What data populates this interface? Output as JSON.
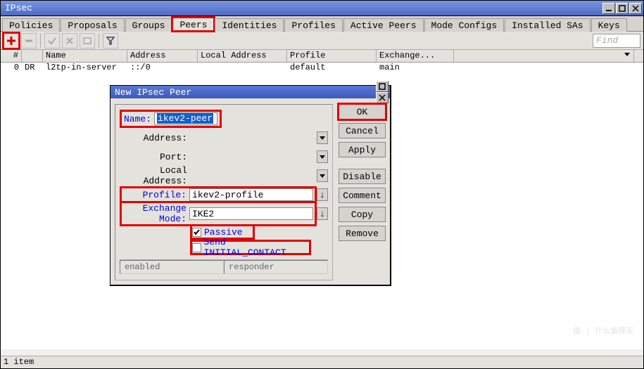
{
  "window": {
    "title": "IPsec"
  },
  "tabs": {
    "items": [
      "Policies",
      "Proposals",
      "Groups",
      "Peers",
      "Identities",
      "Profiles",
      "Active Peers",
      "Mode Configs",
      "Installed SAs",
      "Keys"
    ],
    "active": "Peers"
  },
  "toolbar": {
    "find_placeholder": "Find"
  },
  "table": {
    "columns": [
      "#",
      "",
      "Name",
      "Address",
      "Local Address",
      "Profile",
      "Exchange...",
      ""
    ],
    "rows": [
      {
        "num": "0",
        "flag": "DR",
        "name": "l2tp-in-server",
        "address": "::/0",
        "local_address": "",
        "profile": "default",
        "exchange": "main"
      }
    ]
  },
  "status": {
    "text": "1 item"
  },
  "dialog": {
    "title": "New IPsec Peer",
    "fields": {
      "name_label": "Name:",
      "name_value": "ikev2-peer",
      "address_label": "Address:",
      "address_value": "",
      "port_label": "Port:",
      "port_value": "",
      "local_address_label": "Local Address:",
      "local_address_value": "",
      "profile_label": "Profile:",
      "profile_value": "ikev2-profile",
      "exchange_label": "Exchange Mode:",
      "exchange_value": "IKE2",
      "passive_label": "Passive",
      "passive_checked": true,
      "send_initial_label": "Send INITIAL_CONTACT",
      "send_initial_checked": false
    },
    "buttons": {
      "ok": "OK",
      "cancel": "Cancel",
      "apply": "Apply",
      "disable": "Disable",
      "comment": "Comment",
      "copy": "Copy",
      "remove": "Remove"
    },
    "status_left": "enabled",
    "status_right": "responder"
  },
  "watermark": "值 | 什么值得买"
}
